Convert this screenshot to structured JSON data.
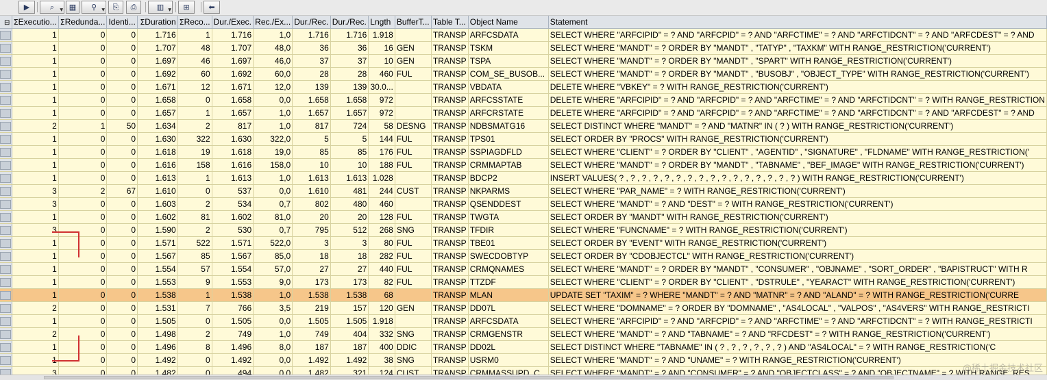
{
  "toolbar": {
    "buttons": [
      {
        "name": "execute-button",
        "icon": "play-icon",
        "glyph": "▶",
        "dropdown": false
      },
      {
        "name": "find-button",
        "icon": "search-icon",
        "glyph": "⌕",
        "dropdown": true
      },
      {
        "name": "layout-button",
        "icon": "table-icon",
        "glyph": "▦",
        "dropdown": false
      },
      {
        "name": "filter-button",
        "icon": "filter-icon",
        "glyph": "⚲",
        "dropdown": true
      },
      {
        "name": "export-button",
        "icon": "export-icon",
        "glyph": "⎘",
        "dropdown": false
      },
      {
        "name": "print-button",
        "icon": "print-icon",
        "glyph": "⎙",
        "dropdown": false
      },
      {
        "name": "view-button",
        "icon": "columns-icon",
        "glyph": "▥",
        "dropdown": true
      },
      {
        "name": "details-button",
        "icon": "details-icon",
        "glyph": "⊞",
        "dropdown": false
      },
      {
        "name": "back-button",
        "icon": "arrow-left-icon",
        "glyph": "⬅",
        "dropdown": false
      }
    ]
  },
  "table": {
    "columns": [
      {
        "key": "execution",
        "label": "Executio...",
        "sigma": true
      },
      {
        "key": "redundant",
        "label": "Redunda...",
        "sigma": true
      },
      {
        "key": "identical",
        "label": "Identi...",
        "sigma": false
      },
      {
        "key": "duration",
        "label": "Duration",
        "sigma": true
      },
      {
        "key": "records",
        "label": "Reco...",
        "sigma": true
      },
      {
        "key": "dur_exec",
        "label": "Dur./Exec.",
        "sigma": false
      },
      {
        "key": "rec_exec",
        "label": "Rec./Ex...",
        "sigma": false
      },
      {
        "key": "dur_rec",
        "label": "Dur./Rec.",
        "sigma": false
      },
      {
        "key": "dur_rec2",
        "label": "Dur./Rec.",
        "sigma": false
      },
      {
        "key": "length",
        "label": "Lngth",
        "sigma": false
      },
      {
        "key": "buffer",
        "label": "BufferT...",
        "sigma": false
      },
      {
        "key": "table_type",
        "label": "Table T...",
        "sigma": false
      },
      {
        "key": "object_name",
        "label": "Object Name",
        "sigma": false
      },
      {
        "key": "statement",
        "label": "Statement",
        "sigma": false
      }
    ],
    "highlighted_row": 20,
    "rows": [
      [
        "1",
        "0",
        "0",
        "1.716",
        "1",
        "1.716",
        "1,0",
        "1.716",
        "1.716",
        "1.918",
        "",
        "TRANSP",
        "ARFCSDATA",
        "SELECT WHERE \"ARFCIPID\" = ? AND \"ARFCPID\" = ? AND \"ARFCTIME\" = ? AND \"ARFCTIDCNT\" = ? AND \"ARFCDEST\" = ? AND"
      ],
      [
        "1",
        "0",
        "0",
        "1.707",
        "48",
        "1.707",
        "48,0",
        "36",
        "36",
        "16",
        "GEN",
        "TRANSP",
        "TSKM",
        "SELECT WHERE \"MANDT\" = ? ORDER BY \"MANDT\" , \"TATYP\" , \"TAXKM\" WITH RANGE_RESTRICTION('CURRENT')"
      ],
      [
        "1",
        "0",
        "0",
        "1.697",
        "46",
        "1.697",
        "46,0",
        "37",
        "37",
        "10",
        "GEN",
        "TRANSP",
        "TSPA",
        "SELECT WHERE \"MANDT\" = ? ORDER BY \"MANDT\" , \"SPART\" WITH RANGE_RESTRICTION('CURRENT')"
      ],
      [
        "1",
        "0",
        "0",
        "1.692",
        "60",
        "1.692",
        "60,0",
        "28",
        "28",
        "460",
        "FUL",
        "TRANSP",
        "COM_SE_BUSOB...",
        "SELECT WHERE \"MANDT\" = ? ORDER BY \"MANDT\" , \"BUSOBJ\" , \"OBJECT_TYPE\" WITH RANGE_RESTRICTION('CURRENT')"
      ],
      [
        "1",
        "0",
        "0",
        "1.671",
        "12",
        "1.671",
        "12,0",
        "139",
        "139",
        "30.0...",
        "",
        "TRANSP",
        "VBDATA",
        "DELETE WHERE \"VBKEY\" = ? WITH RANGE_RESTRICTION('CURRENT')"
      ],
      [
        "1",
        "0",
        "0",
        "1.658",
        "0",
        "1.658",
        "0,0",
        "1.658",
        "1.658",
        "972",
        "",
        "TRANSP",
        "ARFCSSTATE",
        "DELETE WHERE \"ARFCIPID\" = ? AND \"ARFCPID\" = ? AND \"ARFCTIME\" = ? AND \"ARFCTIDCNT\" = ? WITH RANGE_RESTRICTION"
      ],
      [
        "1",
        "0",
        "0",
        "1.657",
        "1",
        "1.657",
        "1,0",
        "1.657",
        "1.657",
        "972",
        "",
        "TRANSP",
        "ARFCRSTATE",
        "DELETE WHERE \"ARFCIPID\" = ? AND \"ARFCPID\" = ? AND \"ARFCTIME\" = ? AND \"ARFCTIDCNT\" = ? AND \"ARFCDEST\" = ? AND"
      ],
      [
        "2",
        "1",
        "50",
        "1.634",
        "2",
        "817",
        "1,0",
        "817",
        "724",
        "58",
        "DESNG",
        "TRANSP",
        "NDBSMATG16",
        "SELECT DISTINCT WHERE \"MANDT\" = ? AND \"MATNR\" IN ( ? ) WITH RANGE_RESTRICTION('CURRENT')"
      ],
      [
        "1",
        "0",
        "0",
        "1.630",
        "322",
        "1.630",
        "322,0",
        "5",
        "5",
        "144",
        "FUL",
        "TRANSP",
        "TPS01",
        "SELECT ORDER BY \"PROCS\"  WITH RANGE_RESTRICTION('CURRENT')"
      ],
      [
        "1",
        "0",
        "0",
        "1.618",
        "19",
        "1.618",
        "19,0",
        "85",
        "85",
        "176",
        "FUL",
        "TRANSP",
        "SSPIAGDFLD",
        "SELECT WHERE \"CLIENT\" = ? ORDER BY \"CLIENT\" , \"AGENTID\" , \"SIGNATURE\" , \"FLDNAME\" WITH RANGE_RESTRICTION('"
      ],
      [
        "1",
        "0",
        "0",
        "1.616",
        "158",
        "1.616",
        "158,0",
        "10",
        "10",
        "188",
        "FUL",
        "TRANSP",
        "CRMMAPTAB",
        "SELECT WHERE \"MANDT\" = ? ORDER BY \"MANDT\" , \"TABNAME\" , \"BEF_IMAGE\" WITH RANGE_RESTRICTION('CURRENT')"
      ],
      [
        "1",
        "0",
        "0",
        "1.613",
        "1",
        "1.613",
        "1,0",
        "1.613",
        "1.613",
        "1.028",
        "",
        "TRANSP",
        "BDCP2",
        "INSERT VALUES( ? , ? , ? , ? , ? , ? , ? , ? , ? , ? , ? , ? , ? , ? , ? , ? ) WITH RANGE_RESTRICTION('CURRENT')"
      ],
      [
        "3",
        "2",
        "67",
        "1.610",
        "0",
        "537",
        "0,0",
        "1.610",
        "481",
        "244",
        "CUST",
        "TRANSP",
        "NKPARMS",
        "SELECT WHERE \"PAR_NAME\" = ? WITH RANGE_RESTRICTION('CURRENT')"
      ],
      [
        "3",
        "0",
        "0",
        "1.603",
        "2",
        "534",
        "0,7",
        "802",
        "480",
        "460",
        "",
        "TRANSP",
        "QSENDDEST",
        "SELECT WHERE \"MANDT\" = ? AND \"DEST\" = ? WITH RANGE_RESTRICTION('CURRENT')"
      ],
      [
        "1",
        "0",
        "0",
        "1.602",
        "81",
        "1.602",
        "81,0",
        "20",
        "20",
        "128",
        "FUL",
        "TRANSP",
        "TWGTA",
        "SELECT ORDER BY \"MANDT\"  WITH RANGE_RESTRICTION('CURRENT')"
      ],
      [
        "3",
        "0",
        "0",
        "1.590",
        "2",
        "530",
        "0,7",
        "795",
        "512",
        "268",
        "SNG",
        "TRANSP",
        "TFDIR",
        "SELECT WHERE \"FUNCNAME\" = ? WITH RANGE_RESTRICTION('CURRENT')"
      ],
      [
        "1",
        "0",
        "0",
        "1.571",
        "522",
        "1.571",
        "522,0",
        "3",
        "3",
        "80",
        "FUL",
        "TRANSP",
        "TBE01",
        "SELECT ORDER BY \"EVENT\"  WITH RANGE_RESTRICTION('CURRENT')"
      ],
      [
        "1",
        "0",
        "0",
        "1.567",
        "85",
        "1.567",
        "85,0",
        "18",
        "18",
        "282",
        "FUL",
        "TRANSP",
        "SWECDOBTYP",
        "SELECT ORDER BY \"CDOBJECTCL\"  WITH RANGE_RESTRICTION('CURRENT')"
      ],
      [
        "1",
        "0",
        "0",
        "1.554",
        "57",
        "1.554",
        "57,0",
        "27",
        "27",
        "440",
        "FUL",
        "TRANSP",
        "CRMQNAMES",
        "SELECT WHERE \"MANDT\" = ? ORDER BY \"MANDT\" , \"CONSUMER\" , \"OBJNAME\" , \"SORT_ORDER\" , \"BAPISTRUCT\" WITH R"
      ],
      [
        "1",
        "0",
        "0",
        "1.553",
        "9",
        "1.553",
        "9,0",
        "173",
        "173",
        "82",
        "FUL",
        "TRANSP",
        "TTZDF",
        "SELECT WHERE \"CLIENT\" = ? ORDER BY \"CLIENT\" , \"DSTRULE\" , \"YEARACT\" WITH RANGE_RESTRICTION('CURRENT')"
      ],
      [
        "1",
        "0",
        "0",
        "1.538",
        "1",
        "1.538",
        "1,0",
        "1.538",
        "1.538",
        "68",
        "",
        "TRANSP",
        "MLAN",
        "UPDATE SET \"TAXIM\" = ? WHERE \"MANDT\" = ? AND \"MATNR\" = ? AND \"ALAND\" = ? WITH RANGE_RESTRICTION('CURRE"
      ],
      [
        "2",
        "0",
        "0",
        "1.531",
        "7",
        "766",
        "3,5",
        "219",
        "157",
        "120",
        "GEN",
        "TRANSP",
        "DD07L",
        "SELECT WHERE \"DOMNAME\" = ? ORDER BY \"DOMNAME\" , \"AS4LOCAL\" , \"VALPOS\" , \"AS4VERS\" WITH RANGE_RESTRICTI"
      ],
      [
        "1",
        "0",
        "0",
        "1.505",
        "0",
        "1.505",
        "0,0",
        "1.505",
        "1.505",
        "1.918",
        "",
        "TRANSP",
        "ARFCSDATA",
        "SELECT WHERE \"ARFCIPID\" = ? AND \"ARFCPID\" = ? AND \"ARFCTIME\" = ? AND \"ARFCTIDCNT\" = ? WITH RANGE_RESTRICTI"
      ],
      [
        "2",
        "0",
        "0",
        "1.498",
        "2",
        "749",
        "1,0",
        "749",
        "404",
        "332",
        "SNG",
        "TRANSP",
        "CRMGENSTR",
        "SELECT WHERE \"MANDT\" = ? AND \"TABNAME\" = ? AND \"RFCDEST\" = ? WITH RANGE_RESTRICTION('CURRENT')"
      ],
      [
        "1",
        "0",
        "0",
        "1.496",
        "8",
        "1.496",
        "8,0",
        "187",
        "187",
        "400",
        "DDIC",
        "TRANSP",
        "DD02L",
        "SELECT DISTINCT WHERE \"TABNAME\" IN ( ? , ? , ? , ? , ? , ? ) AND \"AS4LOCAL\" = ? WITH RANGE_RESTRICTION('C"
      ],
      [
        "1",
        "0",
        "0",
        "1.492",
        "0",
        "1.492",
        "0,0",
        "1.492",
        "1.492",
        "38",
        "SNG",
        "TRANSP",
        "USRM0",
        "SELECT WHERE \"MANDT\" = ? AND \"UNAME\" = ? WITH RANGE_RESTRICTION('CURRENT')"
      ],
      [
        "3",
        "0",
        "0",
        "1.482",
        "0",
        "494",
        "0,0",
        "1.482",
        "321",
        "124",
        "CUST",
        "TRANSP",
        "CRMMASSUPD_C...",
        "SELECT WHERE \"MANDT\" = ? AND \"CONSUMER\" = ? AND \"OBJECTCLASS\" = ? AND \"OBJECTNAME\" = ? WITH RANGE_RES"
      ]
    ]
  },
  "watermark": "@稀土掘金技术社区"
}
